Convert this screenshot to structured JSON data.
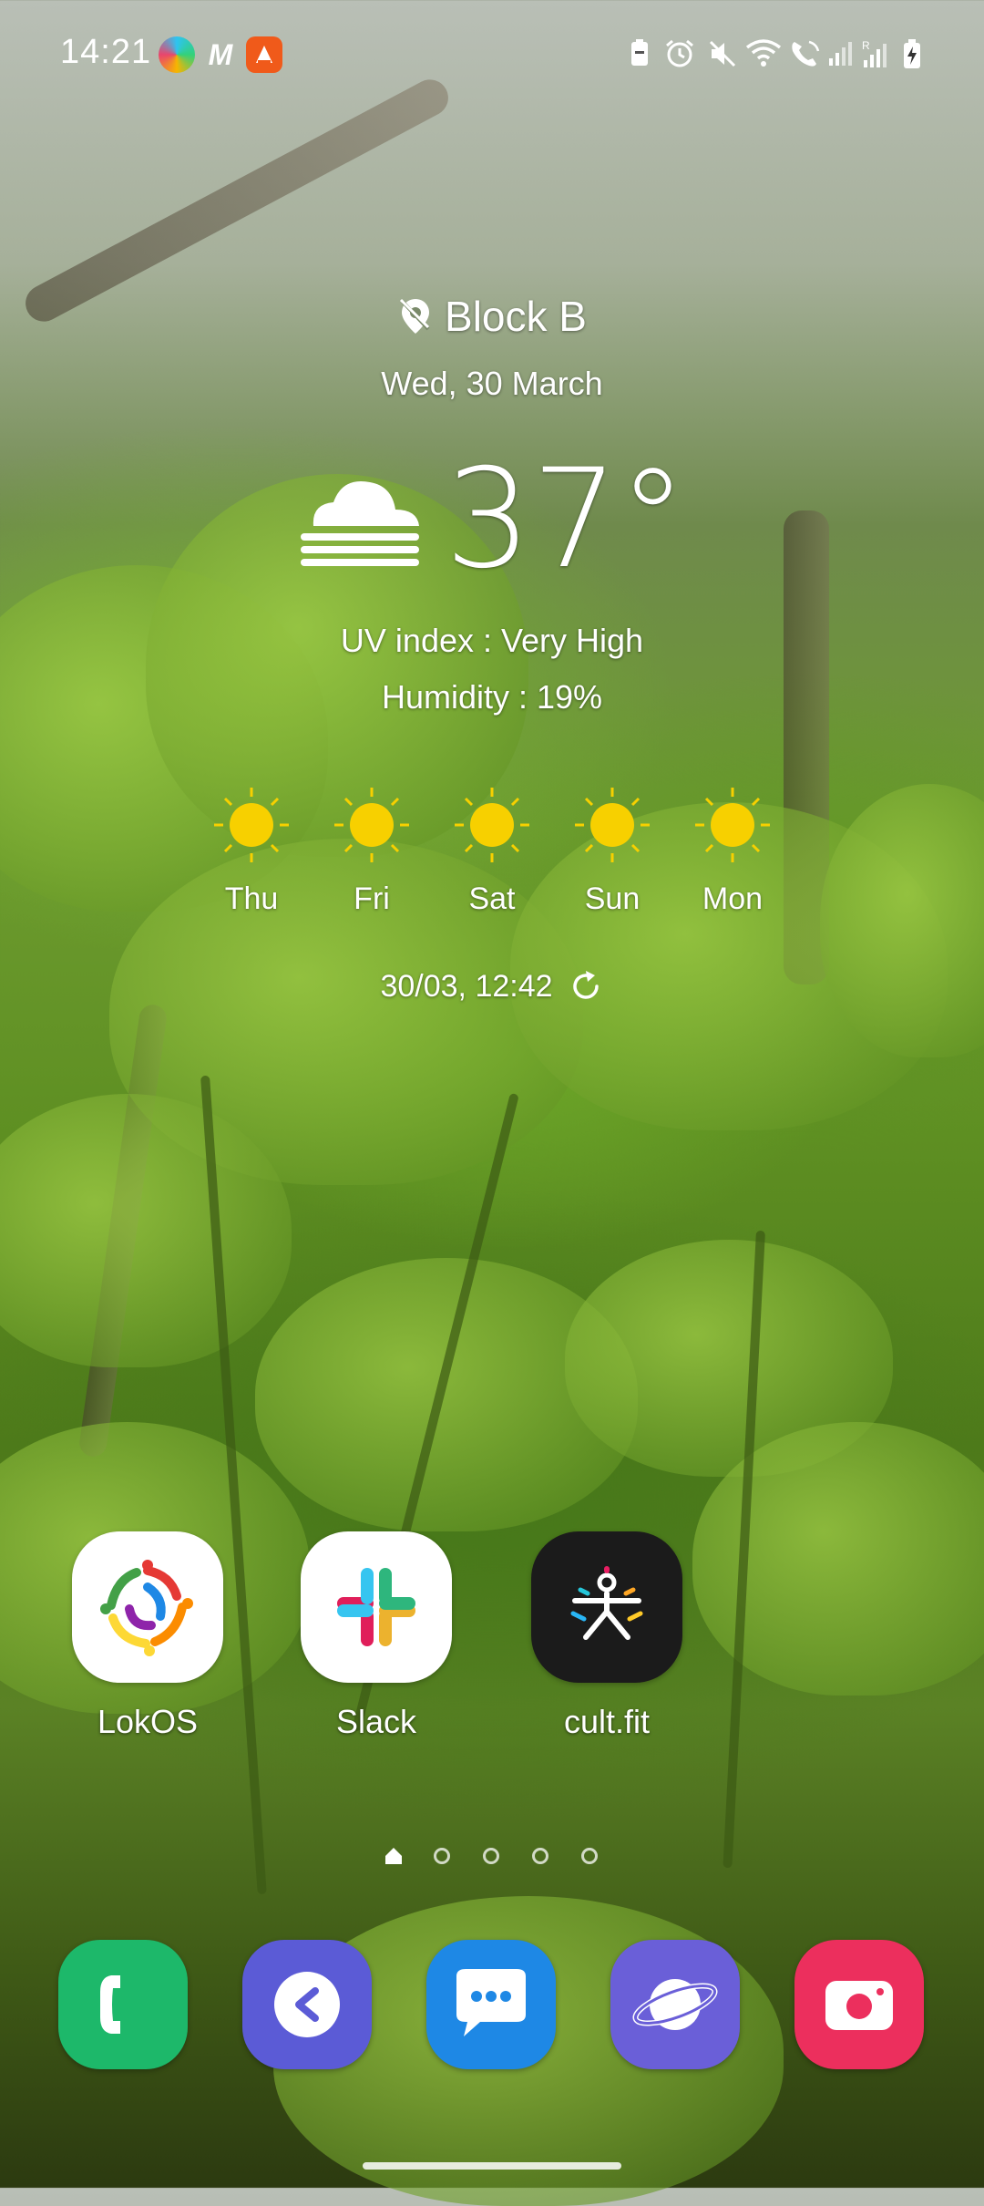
{
  "status_bar": {
    "time": "14:21",
    "notification_icons": [
      "edge-browser-icon",
      "m-app-icon",
      "vlc-icon"
    ],
    "system_icons": [
      "battery-saver-icon",
      "alarm-icon",
      "mute-icon",
      "wifi-icon",
      "wifi-calling-icon",
      "signal-icon",
      "signal-roaming-icon",
      "battery-charging-icon"
    ],
    "roaming_indicator": "R"
  },
  "weather": {
    "location": "Block B",
    "date": "Wed, 30 March",
    "temperature": "37°",
    "condition_icon": "fog-cloud-icon",
    "uv": "UV index : Very High",
    "humidity": "Humidity : 19%",
    "forecast": [
      {
        "day": "Thu",
        "icon": "sun-icon"
      },
      {
        "day": "Fri",
        "icon": "sun-icon"
      },
      {
        "day": "Sat",
        "icon": "sun-icon"
      },
      {
        "day": "Sun",
        "icon": "sun-icon"
      },
      {
        "day": "Mon",
        "icon": "sun-icon"
      }
    ],
    "updated": "30/03, 12:42",
    "refresh_icon": "refresh-icon"
  },
  "apps": [
    {
      "label": "LokOS"
    },
    {
      "label": "Slack"
    },
    {
      "label": "cult.fit"
    }
  ],
  "page_indicator": {
    "total": 5,
    "current": 1,
    "home_icon": "home-icon"
  },
  "dock": [
    "phone-icon",
    "direct-share-icon",
    "messages-icon",
    "internet-browser-icon",
    "camera-icon"
  ],
  "colors": {
    "sun": "#f7d000",
    "phone": "#1db86a",
    "direct": "#5b5bd6",
    "messages": "#1e88e5",
    "browser": "#6a5fd8",
    "camera": "#ec2f5d",
    "cultfit": "#1b1b1b"
  }
}
